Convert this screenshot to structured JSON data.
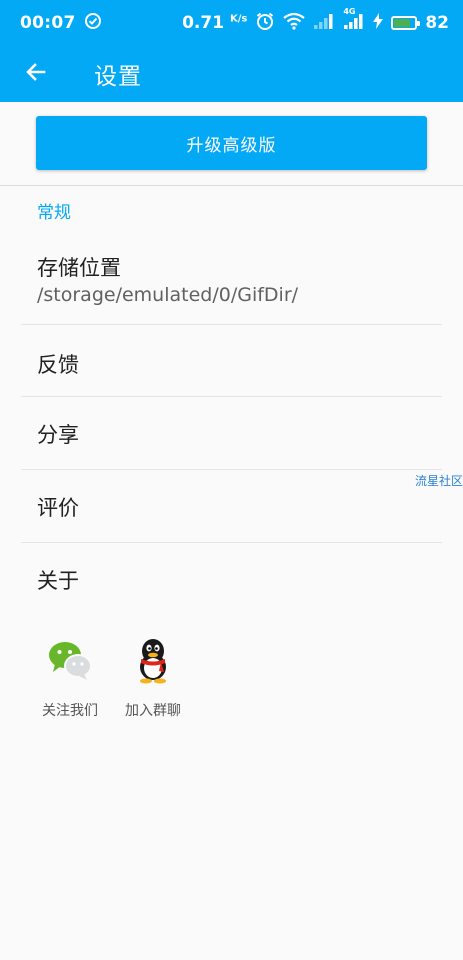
{
  "status_bar": {
    "time": "00:07",
    "speed": "0.71",
    "speed_unit": "K/s",
    "network_label": "4G",
    "battery": "82",
    "battery_level": 0.82,
    "accent": "#03a9f4"
  },
  "app_bar": {
    "back_icon": "arrow-left-icon",
    "title": "设置"
  },
  "upgrade": {
    "label": "升级高级版"
  },
  "general_section": {
    "header": "常规",
    "items": [
      {
        "title": "存储位置",
        "summary": "/storage/emulated/0/GifDir/"
      },
      {
        "title": "反馈"
      },
      {
        "title": "分享"
      },
      {
        "title": "评价"
      },
      {
        "title": "关于"
      }
    ]
  },
  "watermark": "流星社区",
  "social": [
    {
      "icon": "wechat-icon",
      "label": "关注我们"
    },
    {
      "icon": "qq-penguin-icon",
      "label": "加入群聊"
    }
  ]
}
